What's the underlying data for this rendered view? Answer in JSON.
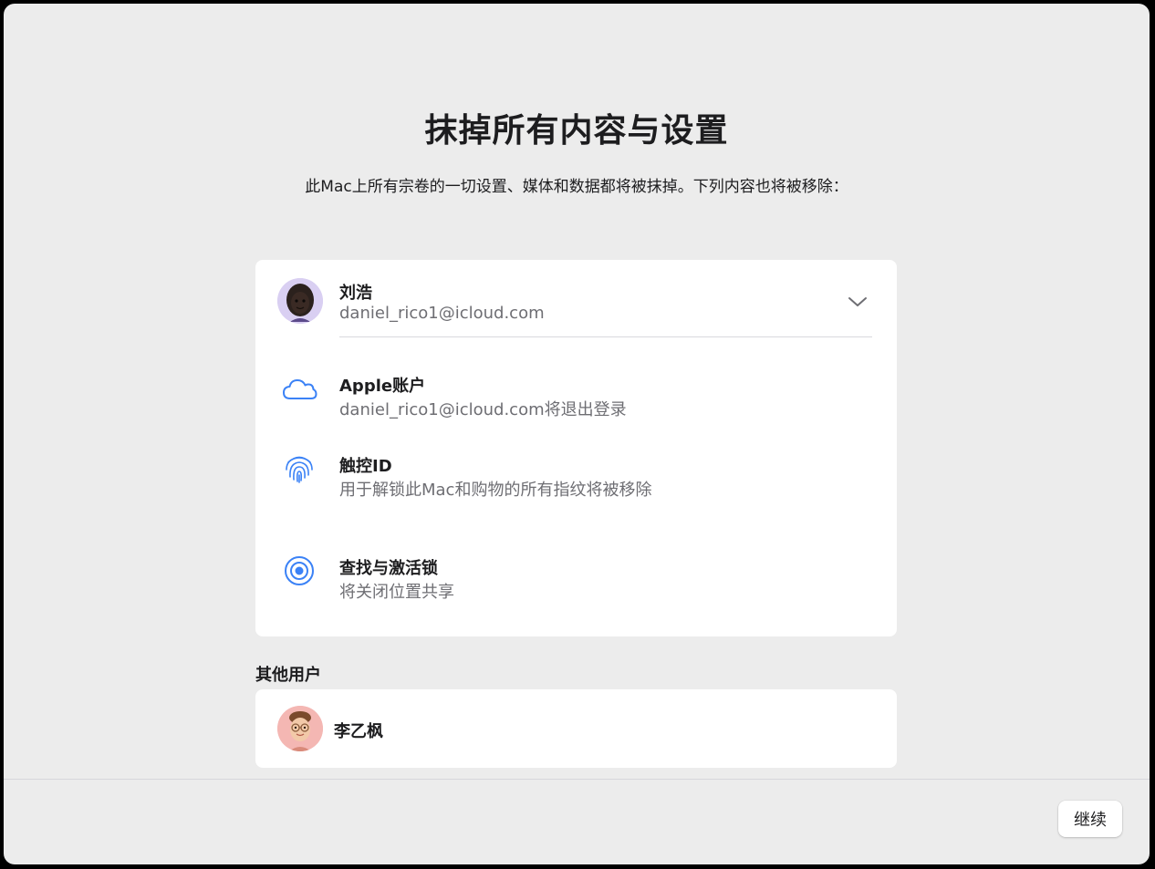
{
  "page": {
    "title": "抹掉所有内容与设置",
    "subtitle": "此Mac上所有宗卷的一切设置、媒体和数据都将被抹掉。下列内容也将被移除："
  },
  "primary_user": {
    "name": "刘浩",
    "email": "daniel_rico1@icloud.com",
    "avatar_icon": "memoji-avatar-dark",
    "expand_icon": "chevron-down-icon"
  },
  "items": [
    {
      "icon": "icloud-icon",
      "title": "Apple账户",
      "description": "daniel_rico1@icloud.com将退出登录"
    },
    {
      "icon": "touch-id-icon",
      "title": "触控ID",
      "description": "用于解锁此Mac和购物的所有指纹将被移除"
    },
    {
      "icon": "find-my-icon",
      "title": "查找与激活锁",
      "description": "将关闭位置共享"
    }
  ],
  "other_users": {
    "label": "其他用户",
    "users": [
      {
        "name": "李乙枫",
        "avatar_icon": "memoji-avatar-glasses"
      }
    ]
  },
  "footer": {
    "continue_label": "继续"
  },
  "colors": {
    "window_bg": "#ececec",
    "card_bg": "#ffffff",
    "icon_blue": "#3b82f6",
    "text_primary": "#1d1d1f",
    "text_secondary": "#6e6e73"
  }
}
